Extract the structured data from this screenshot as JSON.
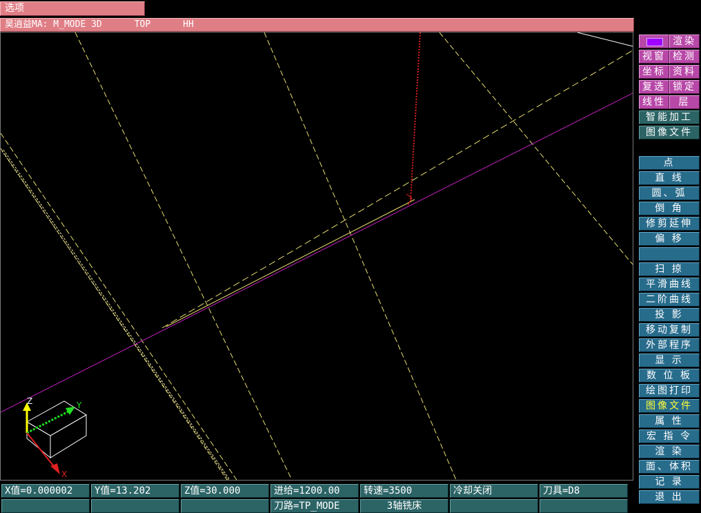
{
  "menu_tab": "选项",
  "title_bar": "昊逍益MA: M_MODE 3D      TOP      HH",
  "axes": {
    "z": "Z",
    "y": "Y",
    "x": "X"
  },
  "colors": {
    "pink_bar": "#e07e86",
    "magenta_button": "#b848a8",
    "teal_button": "#2c6466",
    "blue_button": "#286c8c",
    "active_text": "#ffff3a",
    "swatch": "#a000ff",
    "dashed_lines": "#e8e070",
    "magenta_line": "#c020c0",
    "red_axis": "#e02020"
  },
  "top_panel": [
    {
      "label": "",
      "icon": "color-swatch",
      "style": "magenta"
    },
    {
      "label": "渲染",
      "style": "magenta"
    },
    {
      "label": "视窗",
      "style": "magenta"
    },
    {
      "label": "检测",
      "style": "magenta"
    },
    {
      "label": "坐标",
      "style": "magenta"
    },
    {
      "label": "资料",
      "style": "magenta"
    },
    {
      "label": "复选",
      "style": "magenta"
    },
    {
      "label": "锁定",
      "style": "magenta"
    },
    {
      "label": "线性",
      "style": "magenta"
    },
    {
      "label": "层",
      "style": "magenta"
    },
    {
      "label": "智能加工",
      "style": "teal"
    },
    {
      "label": "图像文件",
      "style": "teal"
    }
  ],
  "menu": [
    "点",
    "直 线",
    "圆、弧",
    "倒 角",
    "修剪延伸",
    "偏 移",
    "",
    "扫 掠",
    "平滑曲线",
    "二阶曲线",
    "投 影",
    "移动复制",
    "外部程序",
    "显 示",
    "数 位 板",
    "绘图打印",
    "图像文件",
    "属 性",
    "宏 指 令",
    "渲 染",
    "面、体积",
    "记 录",
    "退 出"
  ],
  "active_menu_item": "图像文件",
  "status_row1": [
    "X值=0.000002",
    "Y值=13.202",
    "Z值=30.000",
    "进给=1200.00",
    "转速=3500",
    "冷却关闭",
    "刀具=D8"
  ],
  "status_row2": [
    "",
    "",
    "",
    "刀路=TP_MODE",
    "3轴铣床",
    "",
    ""
  ]
}
